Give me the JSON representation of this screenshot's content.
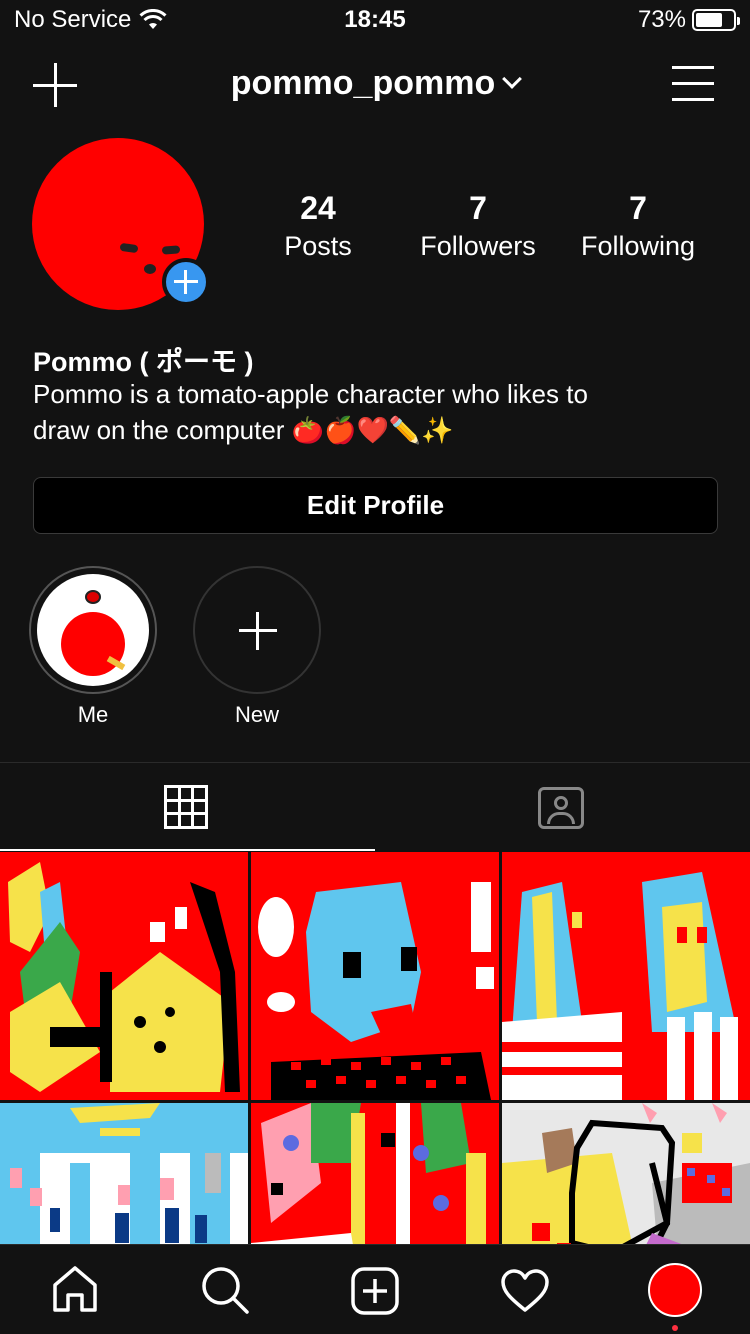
{
  "status_bar": {
    "carrier": "No Service",
    "time": "18:45",
    "battery_pct": "73%",
    "battery_level": 0.73
  },
  "header": {
    "username": "pommo_pommo"
  },
  "profile": {
    "display_name": "Pommo ( ポーモ )",
    "bio_line1": "Pommo is a tomato-apple character who likes to",
    "bio_line2": "draw on the computer 🍅🍎❤️✏️✨",
    "edit_label": "Edit Profile",
    "stats": {
      "posts_count": "24",
      "posts_label": "Posts",
      "followers_count": "7",
      "followers_label": "Followers",
      "following_count": "7",
      "following_label": "Following"
    }
  },
  "highlights": [
    {
      "label": "Me"
    },
    {
      "label": "New"
    }
  ],
  "tabs": [
    "grid-icon",
    "tagged-icon"
  ],
  "posts": [
    {
      "name": "post-1"
    },
    {
      "name": "post-2"
    },
    {
      "name": "post-3"
    },
    {
      "name": "post-4"
    },
    {
      "name": "post-5"
    },
    {
      "name": "post-6"
    }
  ],
  "bottom_nav": [
    "home-icon",
    "search-icon",
    "new-post-icon",
    "activity-icon",
    "profile-avatar"
  ],
  "colors": {
    "background": "#121212",
    "accent_blue": "#3897f0",
    "avatar_red": "#ff0000"
  }
}
